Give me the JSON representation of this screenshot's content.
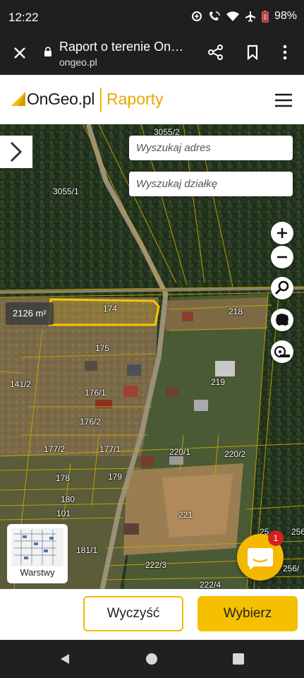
{
  "status_bar": {
    "time": "12:22",
    "battery": "98%",
    "icons": [
      "data-saver-icon",
      "wifi-calling-icon",
      "wifi-icon",
      "airplane-icon",
      "battery-icon"
    ]
  },
  "browser": {
    "title": "Raport o terenie On…",
    "url": "ongeo.pl",
    "icons": [
      "close-icon",
      "lock-icon",
      "share-icon",
      "bookmark-icon",
      "more-vert-icon"
    ]
  },
  "header": {
    "logo_text": "OnGeo.pl",
    "section": "Raporty",
    "accent_color": "#f5b800"
  },
  "map": {
    "search_address_placeholder": "Wyszukaj adres",
    "search_parcel_placeholder": "Wyszukaj działkę",
    "area_badge": "2126 m²",
    "layers_label": "Warstwy",
    "chat_badge_count": "1",
    "controls": [
      "zoom-in-icon",
      "zoom-out-icon",
      "search-icon",
      "poland-map-icon",
      "measure-tape-icon"
    ],
    "parcels": [
      "3055/2",
      "3055/1",
      "174",
      "218",
      "175",
      "141/2",
      "176/1",
      "219",
      "176/2",
      "177/2",
      "177/1",
      "220/1",
      "220/2",
      "178",
      "179",
      "180",
      "101",
      "221",
      "181/1",
      "222/3",
      "222/4",
      "256/",
      "25",
      "256"
    ]
  },
  "actions": {
    "clear_label": "Wyczyść",
    "select_label": "Wybierz"
  }
}
